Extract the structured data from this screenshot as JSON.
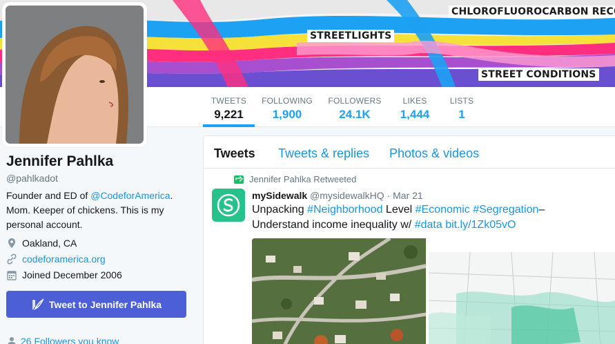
{
  "banner": {
    "labels": [
      "CHLOROFLUOROCARBON RECOV",
      "STREETLIGHTS",
      "STREET CONDITIONS"
    ]
  },
  "nav": {
    "stats": [
      {
        "label": "TWEETS",
        "value": "9,221"
      },
      {
        "label": "FOLLOWING",
        "value": "1,900"
      },
      {
        "label": "FOLLOWERS",
        "value": "24.1K"
      },
      {
        "label": "LIKES",
        "value": "1,444"
      },
      {
        "label": "LISTS",
        "value": "1"
      }
    ]
  },
  "profile": {
    "name": "Jennifer Pahlka",
    "handle": "@pahlkadot",
    "bio_pre": "Founder and ED of ",
    "bio_link": "@CodeforAmerica",
    "bio_post": ". Mom. Keeper of chickens. This is my personal account.",
    "location": "Oakland, CA",
    "website": "codeforamerica.org",
    "joined": "Joined December 2006",
    "tweet_to_label": "Tweet to Jennifer Pahlka",
    "followers_you_know": "26 Followers you know"
  },
  "timeline": {
    "tabs": [
      "Tweets",
      "Tweets & replies",
      "Photos & videos"
    ],
    "retweet_note": "Jennifer Pahlka Retweeted",
    "tweet": {
      "author": "mySidewalk",
      "handle": "@mysidewalkHQ",
      "sep": " · ",
      "date": "Mar 21",
      "t1": "Unpacking ",
      "tag1": "#Neighborhood",
      "t2": " Level ",
      "tag2": "#Economic",
      "t3": " ",
      "tag3": "#Segregation",
      "t4": "–",
      "t5": "Understand income inequality w/ ",
      "tag4": "#data",
      "t6": " ",
      "link": "bit.ly/1Zk05vO"
    }
  },
  "colors": {
    "accent": "#1da1f2",
    "link": "#1b95e0",
    "button": "#4c5fd7",
    "brand_green": "#27c28b"
  }
}
